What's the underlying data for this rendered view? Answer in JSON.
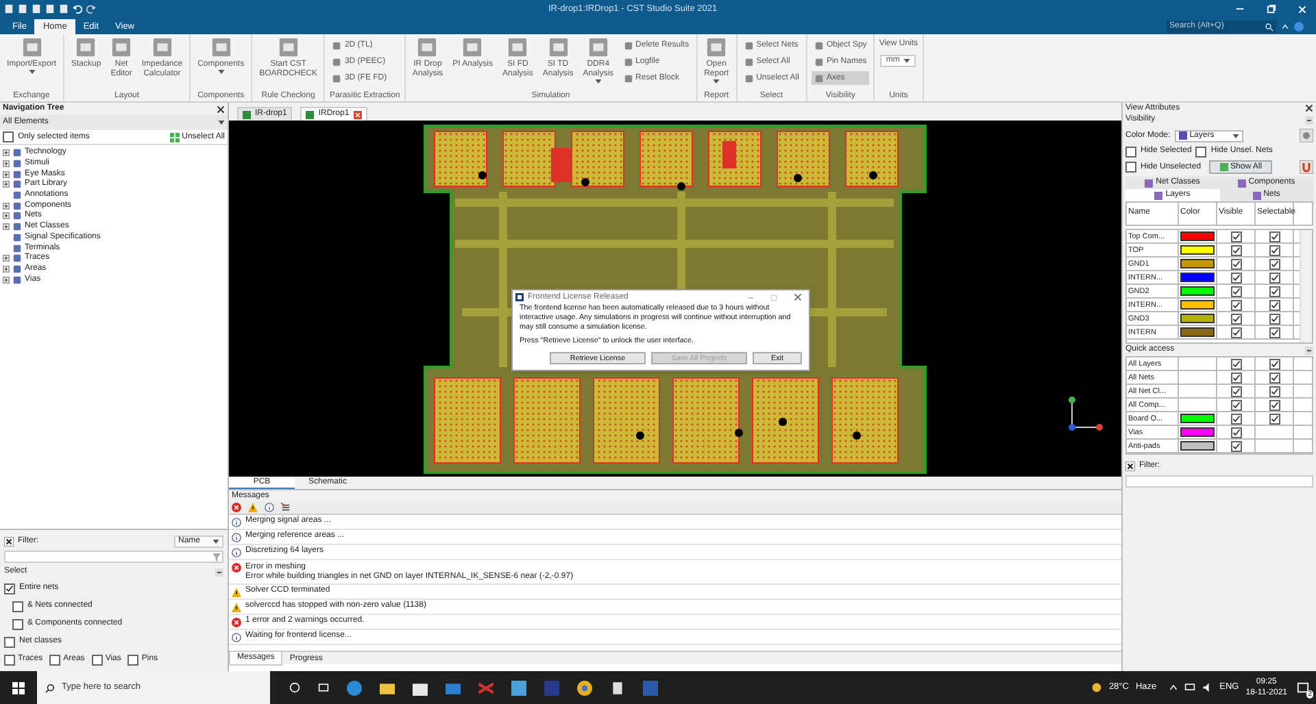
{
  "window": {
    "title": "IR-drop1:IRDrop1 - CST Studio Suite 2021"
  },
  "menu_tabs": [
    {
      "label": "File",
      "selected": false
    },
    {
      "label": "Home",
      "selected": true
    },
    {
      "label": "Edit",
      "selected": false
    },
    {
      "label": "View",
      "selected": false
    }
  ],
  "search": {
    "placeholder": "Search (Alt+Q)"
  },
  "ribbon": [
    {
      "label": "Exchange",
      "buttons": [
        {
          "kind": "large",
          "label": "Import/Export",
          "caret": true
        }
      ]
    },
    {
      "label": "Layout",
      "buttons": [
        {
          "kind": "large",
          "label": "Stackup",
          "caret": false
        },
        {
          "kind": "large",
          "label": "Net\nEditor",
          "caret": false
        },
        {
          "kind": "large",
          "label": "Impedance\nCalculator",
          "caret": false
        }
      ]
    },
    {
      "label": "Components",
      "buttons": [
        {
          "kind": "large",
          "label": "Components",
          "caret": true
        }
      ]
    },
    {
      "label": "Rule Checking",
      "buttons": [
        {
          "kind": "large",
          "label": "Start CST\nBOARDCHECK",
          "caret": false
        }
      ]
    },
    {
      "label": "Parasitic Extraction",
      "buttons": [
        {
          "kind": "small",
          "label": "2D (TL)"
        },
        {
          "kind": "small",
          "label": "3D (PEEC)"
        },
        {
          "kind": "small",
          "label": "3D (FE FD)"
        }
      ]
    },
    {
      "label": "Simulation",
      "buttons": [
        {
          "kind": "large",
          "label": "IR Drop\nAnalysis",
          "caret": false
        },
        {
          "kind": "large",
          "label": "PI Analysis",
          "caret": false
        },
        {
          "kind": "large",
          "label": "SI FD\nAnalysis",
          "caret": false
        },
        {
          "kind": "large",
          "label": "SI TD\nAnalysis",
          "caret": false
        },
        {
          "kind": "large",
          "label": "DDR4\nAnalysis",
          "caret": true
        },
        {
          "kind": "small",
          "label": "Delete Results"
        },
        {
          "kind": "small",
          "label": "Logfile"
        },
        {
          "kind": "small",
          "label": "Reset Block"
        }
      ]
    },
    {
      "label": "Report",
      "buttons": [
        {
          "kind": "large",
          "label": "Open\nReport",
          "caret": true
        }
      ]
    },
    {
      "label": "Select",
      "buttons": [
        {
          "kind": "small",
          "label": "Select Nets"
        },
        {
          "kind": "small",
          "label": "Select All"
        },
        {
          "kind": "small",
          "label": "Unselect All"
        }
      ]
    },
    {
      "label": "Visibility",
      "buttons": [
        {
          "kind": "small",
          "label": "Object Spy",
          "selected": false
        },
        {
          "kind": "small",
          "label": "Pin Names",
          "selected": false
        },
        {
          "kind": "small",
          "label": "Axes",
          "selected": true
        }
      ]
    },
    {
      "label": "Units",
      "buttons": [
        {
          "kind": "dropdown",
          "label": "View Units",
          "value": "mm"
        }
      ]
    }
  ],
  "navigation_tree": {
    "title": "Navigation Tree",
    "scope": "All Elements",
    "only_selected": {
      "label": "Only selected items",
      "checked": false
    },
    "unselect_all": "Unselect All",
    "items": [
      {
        "label": "Technology",
        "expandable": true
      },
      {
        "label": "Stimuli",
        "expandable": true
      },
      {
        "label": "Eye Masks",
        "expandable": true
      },
      {
        "label": "Part Library",
        "expandable": true
      },
      {
        "label": "Annotations",
        "expandable": false
      },
      {
        "label": "Components",
        "expandable": true
      },
      {
        "label": "Nets",
        "expandable": true
      },
      {
        "label": "Net Classes",
        "expandable": true
      },
      {
        "label": "Signal Specifications",
        "expandable": false
      },
      {
        "label": "Terminals",
        "expandable": false
      },
      {
        "label": "Traces",
        "expandable": true
      },
      {
        "label": "Areas",
        "expandable": true
      },
      {
        "label": "Vias",
        "expandable": true
      }
    ]
  },
  "nav_filter": {
    "label": "Filter:",
    "field": "Name",
    "select_title": "Select",
    "options": [
      {
        "label": "Entire nets",
        "checked": true,
        "children": [
          {
            "label": "& Nets connected",
            "checked": false
          },
          {
            "label": "& Components connected",
            "checked": false
          }
        ]
      },
      {
        "label": "Net classes",
        "checked": false
      }
    ],
    "types": [
      {
        "label": "Traces",
        "checked": false
      },
      {
        "label": "Areas",
        "checked": false
      },
      {
        "label": "Vias",
        "checked": false
      },
      {
        "label": "Pins",
        "checked": false
      }
    ]
  },
  "document_tabs": [
    {
      "label": "IR-drop1",
      "selected": false
    },
    {
      "label": "IRDrop1",
      "selected": true
    }
  ],
  "view_tabs": [
    {
      "label": "PCB",
      "selected": true
    },
    {
      "label": "Schematic",
      "selected": false
    }
  ],
  "dialog": {
    "title": "Frontend License Released",
    "message": "The frontend license has been automatically released due to 3 hours without interactive usage. Any simulations in progress will continue without interruption and may still consume a simulation license.",
    "prompt": "Press \"Retrieve License\" to unlock the user interface.",
    "buttons": [
      {
        "label": "Retrieve License",
        "disabled": false
      },
      {
        "label": "Save All Projects",
        "disabled": true
      },
      {
        "label": "Exit",
        "disabled": false
      }
    ]
  },
  "messages": {
    "title": "Messages",
    "rows": [
      {
        "kind": "info",
        "text": "Merging signal areas ..."
      },
      {
        "kind": "info",
        "text": "Merging reference areas ..."
      },
      {
        "kind": "info",
        "text": "Discretizing 64 layers"
      },
      {
        "kind": "error",
        "text": "Error in meshing",
        "detail": "Error while building triangles in net GND on layer INTERNAL_IK_SENSE-6 near (-2,-0.97)"
      },
      {
        "kind": "warning",
        "text": "Solver CCD terminated"
      },
      {
        "kind": "warning",
        "text": "solverccd has stopped with non-zero value (1138)"
      },
      {
        "kind": "error",
        "text": "1 error and 2 warnings occurred."
      },
      {
        "kind": "info",
        "text": "Waiting for frontend license..."
      }
    ],
    "tabs": [
      {
        "label": "Messages",
        "selected": true
      },
      {
        "label": "Progress",
        "selected": false
      }
    ]
  },
  "view_attributes": {
    "title": "View Attributes",
    "visibility": "Visibility",
    "color_mode_label": "Color Mode:",
    "color_mode": "Layers",
    "checks": [
      {
        "label": "Hide Selected",
        "checked": false
      },
      {
        "label": "Hide Unsel. Nets",
        "checked": false
      },
      {
        "label": "Hide Unselected",
        "checked": false
      }
    ],
    "show_all": "Show All",
    "tabs": [
      {
        "label": "Net Classes",
        "selected": false
      },
      {
        "label": "Components",
        "selected": false
      },
      {
        "label": "Layers",
        "selected": true
      },
      {
        "label": "Nets",
        "selected": false
      }
    ],
    "columns": [
      "Name",
      "Color",
      "Visible",
      "Selectable"
    ],
    "layers": [
      {
        "name": "Top Com...",
        "color": "#ff0000",
        "visible": true,
        "selectable": true
      },
      {
        "name": "TOP",
        "color": "#ffff00",
        "visible": true,
        "selectable": true
      },
      {
        "name": "GND1",
        "color": "#c8960a",
        "visible": true,
        "selectable": true
      },
      {
        "name": "INTERN...",
        "color": "#0000ff",
        "visible": true,
        "selectable": true
      },
      {
        "name": "GND2",
        "color": "#00ff00",
        "visible": true,
        "selectable": true
      },
      {
        "name": "INTERN...",
        "color": "#ffc000",
        "visible": true,
        "selectable": true
      },
      {
        "name": "GND3",
        "color": "#b4b400",
        "visible": true,
        "selectable": true
      },
      {
        "name": "INTERN",
        "color": "#8b6914",
        "visible": true,
        "selectable": true
      }
    ],
    "quick_access_title": "Quick access",
    "quick_access": [
      {
        "name": "All Layers",
        "visible": true,
        "selectable": true
      },
      {
        "name": "All Nets",
        "visible": true,
        "selectable": true
      },
      {
        "name": "All Net Cl...",
        "visible": true,
        "selectable": true
      },
      {
        "name": "All Comp...",
        "visible": true,
        "selectable": true
      },
      {
        "name": "Board O...",
        "color": "#00ff00",
        "visible": true,
        "selectable": true
      },
      {
        "name": "Vias",
        "color": "#ff00ff",
        "visible": true
      },
      {
        "name": "Anti-pads",
        "color": "#c0c0c0",
        "visible": true
      }
    ],
    "filter_label": "Filter:"
  },
  "taskbar": {
    "search_placeholder": "Type here to search",
    "temperature": "28°C",
    "weather": "Haze",
    "language": "ENG",
    "time": "09:25",
    "date": "18-11-2021",
    "notifications": "2"
  }
}
